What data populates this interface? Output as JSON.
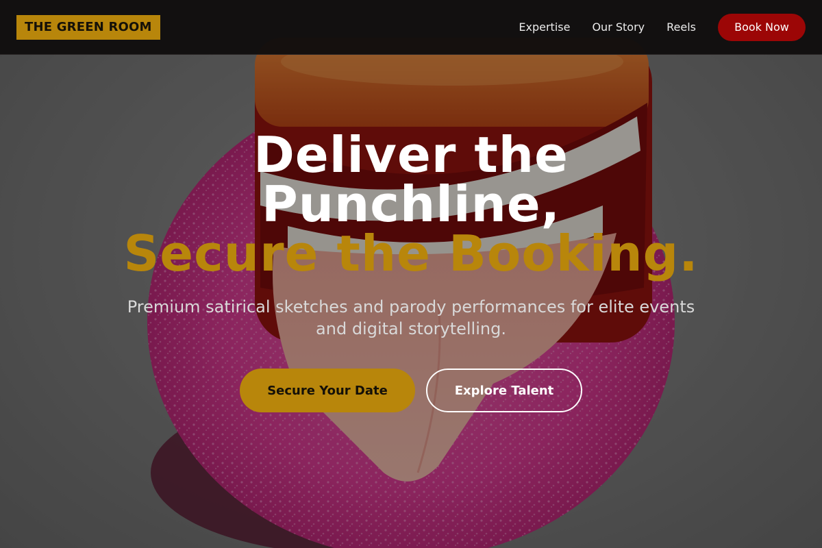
{
  "brand": {
    "logo_text": "THE GREEN ROOM"
  },
  "nav": {
    "links": [
      {
        "label": "Expertise"
      },
      {
        "label": "Our Story"
      },
      {
        "label": "Reels"
      }
    ],
    "cta_label": "Book Now"
  },
  "hero": {
    "headline_line1": "Deliver the",
    "headline_line2": "Punchline,",
    "headline_accent": "Secure the Booking.",
    "subtitle": "Premium satirical sketches and parody performances for elite events and digital storytelling.",
    "primary_cta": "Secure Your Date",
    "secondary_cta": "Explore Talent"
  },
  "colors": {
    "accent_gold": "#b8860b",
    "book_now_red": "#9c0606",
    "navbar_bg": "#100e0e"
  }
}
